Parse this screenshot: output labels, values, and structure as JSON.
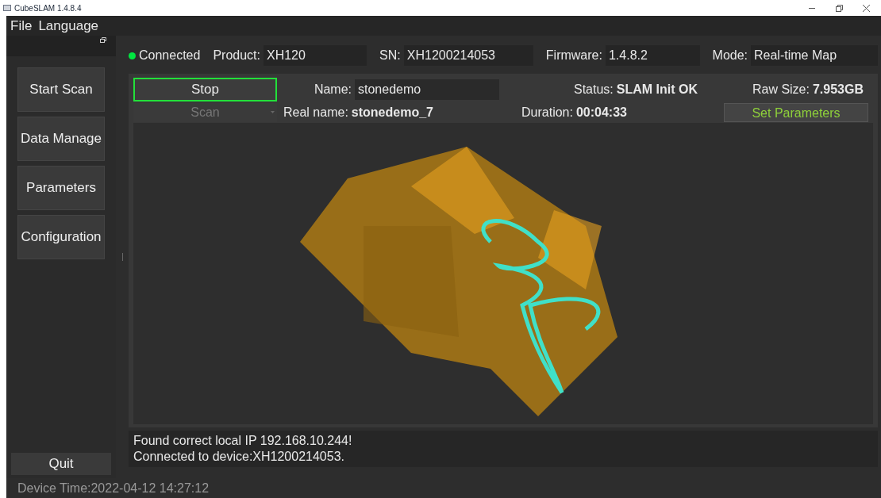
{
  "window": {
    "title": "CubeSLAM 1.4.8.4"
  },
  "menu": [
    "File",
    "Language"
  ],
  "sidebar": {
    "items": [
      "Start Scan",
      "Data Manage",
      "Parameters",
      "Configuration"
    ],
    "quit": "Quit"
  },
  "info_bar": {
    "connection": {
      "label": "Connected",
      "connected": true
    },
    "fields": [
      {
        "label": "Product:",
        "value": "XH120"
      },
      {
        "label": "SN:",
        "value": "XH1200214053"
      },
      {
        "label": "Firmware:",
        "value": "1.4.8.2"
      },
      {
        "label": "Mode:",
        "value": "Real-time Map"
      }
    ]
  },
  "controls": {
    "stop": {
      "label": "Stop",
      "focused": true
    },
    "scan": {
      "label": "Scan",
      "disabled": true
    },
    "name": {
      "label": "Name:",
      "value": "stonedemo"
    },
    "real_name": {
      "label": "Real name:",
      "value": "stonedemo_7"
    },
    "status": {
      "label": "Status:",
      "value": "SLAM Init OK"
    },
    "duration": {
      "label": "Duration:",
      "value": "00:04:33"
    },
    "raw_size": {
      "label": "Raw Size:",
      "value": "7.953GB"
    },
    "set_parameters": "Set Parameters"
  },
  "log": [
    "Found correct local IP 192.168.10.244!",
    "Connected to device:XH1200214053."
  ],
  "status_bar": "Device Time:2022-04-12 14:27:12"
}
